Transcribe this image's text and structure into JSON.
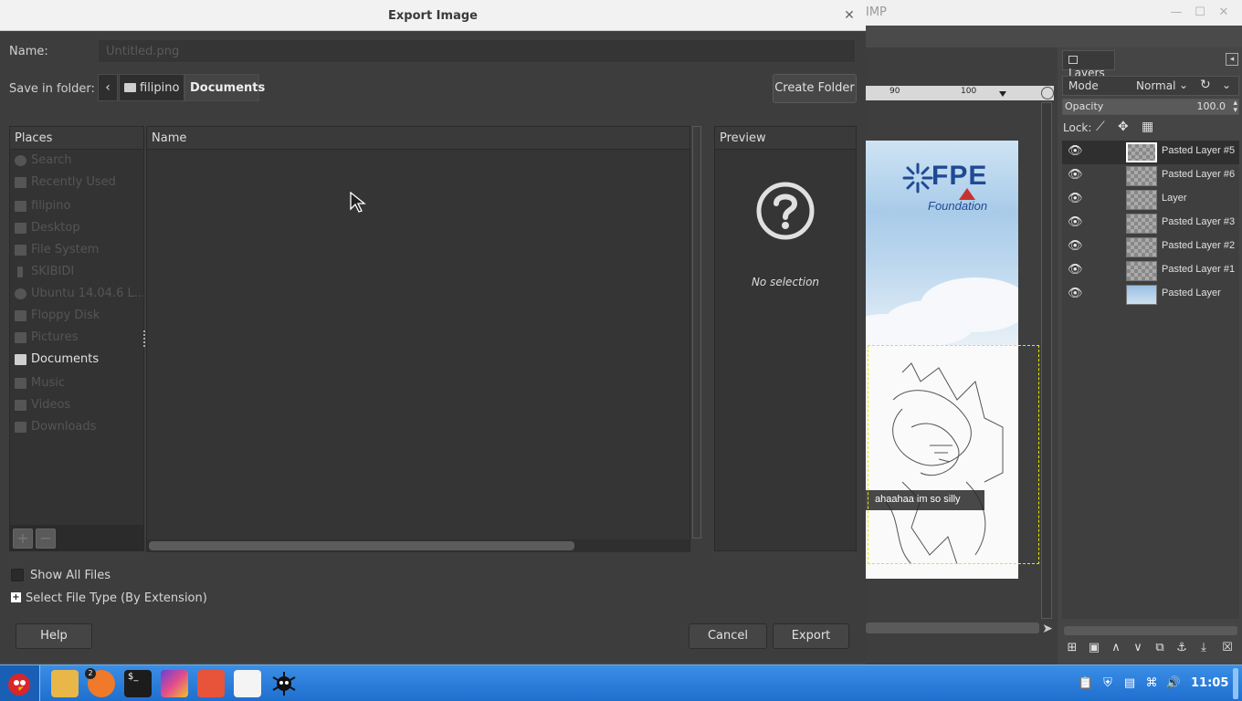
{
  "gimp": {
    "title": "IMP",
    "ruler": {
      "left_label": "90",
      "right_label": "100"
    },
    "image_text": {
      "logo": "FPE",
      "logo_sub": "Foundation",
      "caption": "ahaahaa im so silly"
    },
    "layers_tab": "Layers",
    "mode_label": "Mode",
    "mode_value": "Normal",
    "opacity_label": "Opacity",
    "opacity_value": "100.0",
    "lock_label": "Lock:",
    "layers": [
      {
        "name": "Pasted Layer #5",
        "selected": true
      },
      {
        "name": "Pasted Layer #6"
      },
      {
        "name": "Layer"
      },
      {
        "name": "Pasted Layer #3"
      },
      {
        "name": "Pasted Layer #2"
      },
      {
        "name": "Pasted Layer #1"
      },
      {
        "name": "Pasted Layer"
      }
    ]
  },
  "dialog": {
    "title": "Export Image",
    "name_label": "Name:",
    "name_value": "Untitled.png",
    "save_in_label": "Save in folder:",
    "breadcrumbs": [
      "filipino",
      "Documents"
    ],
    "create_folder": "Create Folder",
    "places_header": "Places",
    "places": [
      {
        "label": "Search"
      },
      {
        "label": "Recently Used"
      },
      {
        "label": "filipino"
      },
      {
        "label": "Desktop"
      },
      {
        "label": "File System"
      },
      {
        "label": "SKIBIDI"
      },
      {
        "label": "Ubuntu 14.04.6 L..."
      },
      {
        "label": "Floppy Disk"
      },
      {
        "label": "Pictures"
      },
      {
        "label": "Documents",
        "active": true
      },
      {
        "label": "Music"
      },
      {
        "label": "Videos"
      },
      {
        "label": "Downloads"
      }
    ],
    "places_add": "+",
    "places_remove": "−",
    "filelist_header": "Name",
    "preview_header": "Preview",
    "preview_text": "No selection",
    "show_all_files": "Show All Files",
    "select_file_type": "Select File Type (By Extension)",
    "help": "Help",
    "cancel": "Cancel",
    "export": "Export"
  },
  "taskbar": {
    "badge_count": "2",
    "clock": "11:05",
    "colors": {
      "bar": "#1f6fcf",
      "accent": "#8ec3f5"
    }
  }
}
